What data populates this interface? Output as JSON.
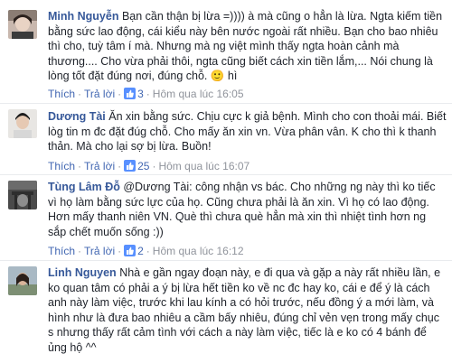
{
  "comments": [
    {
      "author": "Minh Nguyễn",
      "text": "Bạn cần thận bị lừa =)))) à mà cũng o hẳn là lừa. Ngta kiếm tiền bằng sức lao động, cái kiểu này bên nước ngoài rất nhiều. Bạn cho bao nhiêu thì cho, tuỳ tâm í mà. Nhưng mà ng việt mình thấy ngta hoàn cảnh mà thương.... Cho vừa phải thôi, ngta cũng biết cách xin tiền lắm,... Nói chung là lòng tốt đặt đúng nơi, đúng chỗ. 🙂 hì",
      "like_label": "Thích",
      "reply_label": "Trả lời",
      "like_count": "3",
      "time": "Hôm qua lúc 16:05"
    },
    {
      "author": "Dương Tài",
      "text": "Ăn xin bằng sức. Chịu cực k giả bệnh. Mình cho con thoải mái. Biết lòg tin m đc đặt đúg chỗ. Cho mấy ăn xin vn. Vừa phân vân. K cho thì k thanh thản. Mà cho lại sợ bị lừa. Buồn!",
      "like_label": "Thích",
      "reply_label": "Trả lời",
      "like_count": "25",
      "time": "Hôm qua lúc 16:07"
    },
    {
      "author": "Tùng Lâm Đỗ",
      "text": "@Dương Tài: công nhận vs bác. Cho những ng này thì ko tiếc vì họ làm bằng sức lực của họ. Cũng chưa phải là ăn xin. Vì họ có lao động. Hơn mấy thanh niên VN. Què thì chưa què hẳn mà xin thì nhiệt tình hơn ng sắp chết muốn sống :))",
      "like_label": "Thích",
      "reply_label": "Trả lời",
      "like_count": "2",
      "time": "Hôm qua lúc 16:12"
    },
    {
      "author": "Linh Nguyen",
      "text": "Nhà e gần ngay đoạn này, e đi qua và gặp a này rất nhiều lần, e ko quan tâm có phải a ý bị lừa hết tiền ko về nc đc hay ko, cái e để ý là cách anh này làm việc, trước khi lau kính a có hỏi trước, nếu đồng ý a mới làm, và hình như là đưa bao nhiêu a cầm bấy nhiêu, đúng chỉ vẻn vẹn trong mấy chục s nhưng thấy rất cảm tình với cách a này làm việc, tiếc là e ko có 4 bánh để ủng hộ ^^"
    }
  ],
  "colors": {
    "author": "#365899",
    "link": "#4267b2",
    "meta": "#90949c",
    "text": "#1d2129",
    "like_badge": "#5890ff"
  },
  "icons": {
    "like": "thumbs-up-icon"
  }
}
